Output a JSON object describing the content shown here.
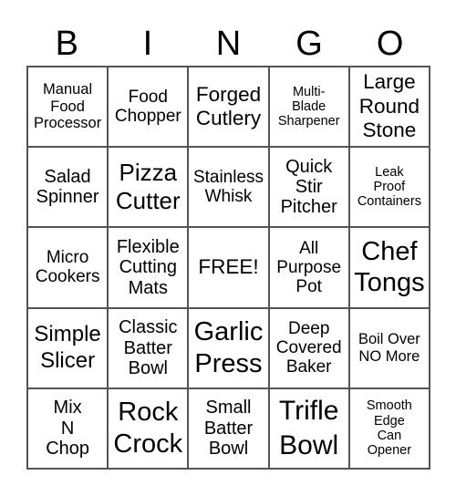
{
  "header": [
    "B",
    "I",
    "N",
    "G",
    "O"
  ],
  "cells": [
    {
      "text": "Manual\nFood\nProcessor",
      "size": "s16"
    },
    {
      "text": "Food\nChopper",
      "size": "s18"
    },
    {
      "text": "Forged\nCutlery",
      "size": "s22"
    },
    {
      "text": "Multi-\nBlade\nSharpener",
      "size": "s14"
    },
    {
      "text": "Large\nRound\nStone",
      "size": "s22"
    },
    {
      "text": "Salad\nSpinner",
      "size": "s20"
    },
    {
      "text": "Pizza\nCutter",
      "size": "s26"
    },
    {
      "text": "Stainless\nWhisk",
      "size": "s18"
    },
    {
      "text": "Quick\nStir\nPitcher",
      "size": "s20"
    },
    {
      "text": "Leak\nProof\nContainers",
      "size": "s14"
    },
    {
      "text": "Micro\nCookers",
      "size": "s18"
    },
    {
      "text": "Flexible\nCutting\nMats",
      "size": "s20"
    },
    {
      "text": "FREE!",
      "size": "s22"
    },
    {
      "text": "All\nPurpose\nPot",
      "size": "s18"
    },
    {
      "text": "Chef\nTongs",
      "size": "s28"
    },
    {
      "text": "Simple\nSlicer",
      "size": "s24"
    },
    {
      "text": "Classic\nBatter\nBowl",
      "size": "s20"
    },
    {
      "text": "Garlic\nPress",
      "size": "s28"
    },
    {
      "text": "Deep\nCovered\nBaker",
      "size": "s18"
    },
    {
      "text": "Boil Over\nNO More",
      "size": "s16"
    },
    {
      "text": "Mix\nN\nChop",
      "size": "s20"
    },
    {
      "text": "Rock\nCrock",
      "size": "s28"
    },
    {
      "text": "Small\nBatter\nBowl",
      "size": "s20"
    },
    {
      "text": "Trifle\nBowl",
      "size": "s30"
    },
    {
      "text": "Smooth\nEdge\nCan\nOpener",
      "size": "s14"
    }
  ]
}
